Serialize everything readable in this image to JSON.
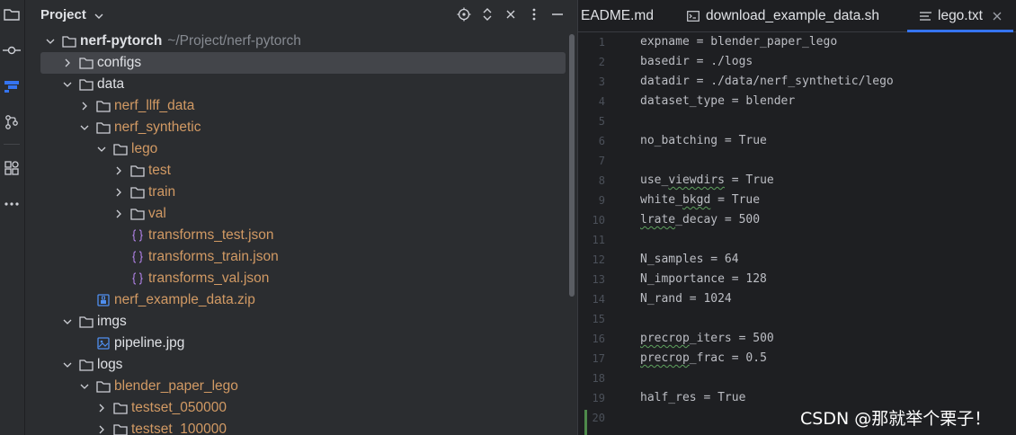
{
  "sidebar": {
    "icons": [
      "folder-icon",
      "commit-icon",
      "structure-icon",
      "git-branch-icon",
      "plugins-icon",
      "more-icon"
    ]
  },
  "project_panel": {
    "title": "Project",
    "header_actions": [
      "locate-icon",
      "expand-collapse-icon",
      "close-icon",
      "more-options-icon",
      "hide-icon"
    ],
    "tree": [
      {
        "label": "nerf-pytorch",
        "hint": "~/Project/nerf-pytorch",
        "depth": 0,
        "chevron": "down",
        "icon": "folder",
        "style": "bold"
      },
      {
        "label": "configs",
        "depth": 1,
        "chevron": "right",
        "icon": "folder",
        "style": "plain",
        "selected": true
      },
      {
        "label": "data",
        "depth": 1,
        "chevron": "down",
        "icon": "folder",
        "style": "plain"
      },
      {
        "label": "nerf_llff_data",
        "depth": 2,
        "chevron": "right",
        "icon": "folder",
        "style": "orange"
      },
      {
        "label": "nerf_synthetic",
        "depth": 2,
        "chevron": "down",
        "icon": "folder",
        "style": "orange"
      },
      {
        "label": "lego",
        "depth": 3,
        "chevron": "down",
        "icon": "folder",
        "style": "orange"
      },
      {
        "label": "test",
        "depth": 4,
        "chevron": "right",
        "icon": "folder",
        "style": "orange"
      },
      {
        "label": "train",
        "depth": 4,
        "chevron": "right",
        "icon": "folder",
        "style": "orange"
      },
      {
        "label": "val",
        "depth": 4,
        "chevron": "right",
        "icon": "folder",
        "style": "orange"
      },
      {
        "label": "transforms_test.json",
        "depth": 4,
        "chevron": "none",
        "icon": "json",
        "style": "orange"
      },
      {
        "label": "transforms_train.json",
        "depth": 4,
        "chevron": "none",
        "icon": "json",
        "style": "orange"
      },
      {
        "label": "transforms_val.json",
        "depth": 4,
        "chevron": "none",
        "icon": "json",
        "style": "orange"
      },
      {
        "label": "nerf_example_data.zip",
        "depth": 2,
        "chevron": "none",
        "icon": "zip",
        "style": "orange"
      },
      {
        "label": "imgs",
        "depth": 1,
        "chevron": "down",
        "icon": "folder",
        "style": "plain"
      },
      {
        "label": "pipeline.jpg",
        "depth": 2,
        "chevron": "none",
        "icon": "image",
        "style": "plain"
      },
      {
        "label": "logs",
        "depth": 1,
        "chevron": "down",
        "icon": "folder",
        "style": "plain"
      },
      {
        "label": "blender_paper_lego",
        "depth": 2,
        "chevron": "down",
        "icon": "folder",
        "style": "orange"
      },
      {
        "label": "testset_050000",
        "depth": 3,
        "chevron": "right",
        "icon": "folder",
        "style": "orange"
      },
      {
        "label": "testset_100000",
        "depth": 3,
        "chevron": "right",
        "icon": "folder",
        "style": "orange"
      }
    ]
  },
  "editor": {
    "tabs": [
      {
        "label": "EADME.md",
        "icon": "markdown-icon",
        "active": false
      },
      {
        "label": "download_example_data.sh",
        "icon": "terminal-icon",
        "active": false
      },
      {
        "label": "lego.txt",
        "icon": "text-file-icon",
        "active": true
      }
    ],
    "lines": [
      {
        "num": "1",
        "text": "expname = blender_paper_lego",
        "squiggle": ""
      },
      {
        "num": "2",
        "text": "basedir = ./logs",
        "squiggle": ""
      },
      {
        "num": "3",
        "text": "datadir = ./data/nerf_synthetic/lego",
        "squiggle": ""
      },
      {
        "num": "4",
        "text": "dataset_type = blender",
        "squiggle": ""
      },
      {
        "num": "5",
        "text": "",
        "squiggle": ""
      },
      {
        "num": "6",
        "text": "no_batching = True",
        "squiggle": ""
      },
      {
        "num": "7",
        "text": "",
        "squiggle": ""
      },
      {
        "num": "8",
        "text": "use_viewdirs = True",
        "squiggle": "viewdirs"
      },
      {
        "num": "9",
        "text": "white_bkgd = True",
        "squiggle": "bkgd"
      },
      {
        "num": "10",
        "text": "lrate_decay = 500",
        "squiggle": "lrate"
      },
      {
        "num": "11",
        "text": "",
        "squiggle": ""
      },
      {
        "num": "12",
        "text": "N_samples = 64",
        "squiggle": ""
      },
      {
        "num": "13",
        "text": "N_importance = 128",
        "squiggle": ""
      },
      {
        "num": "14",
        "text": "N_rand = 1024",
        "squiggle": ""
      },
      {
        "num": "15",
        "text": "",
        "squiggle": ""
      },
      {
        "num": "16",
        "text": "precrop_iters = 500",
        "squiggle": "precrop"
      },
      {
        "num": "17",
        "text": "precrop_frac = 0.5",
        "squiggle": "precrop"
      },
      {
        "num": "18",
        "text": "",
        "squiggle": ""
      },
      {
        "num": "19",
        "text": "half_res = True",
        "squiggle": ""
      },
      {
        "num": "20",
        "text": "",
        "squiggle": ""
      }
    ]
  },
  "watermark": "CSDN @那就举个栗子！",
  "colors": {
    "accent": "#3574f0",
    "folder_orange": "#d29a64",
    "panel_bg": "#2b2d30",
    "editor_bg": "#1e1f22"
  }
}
